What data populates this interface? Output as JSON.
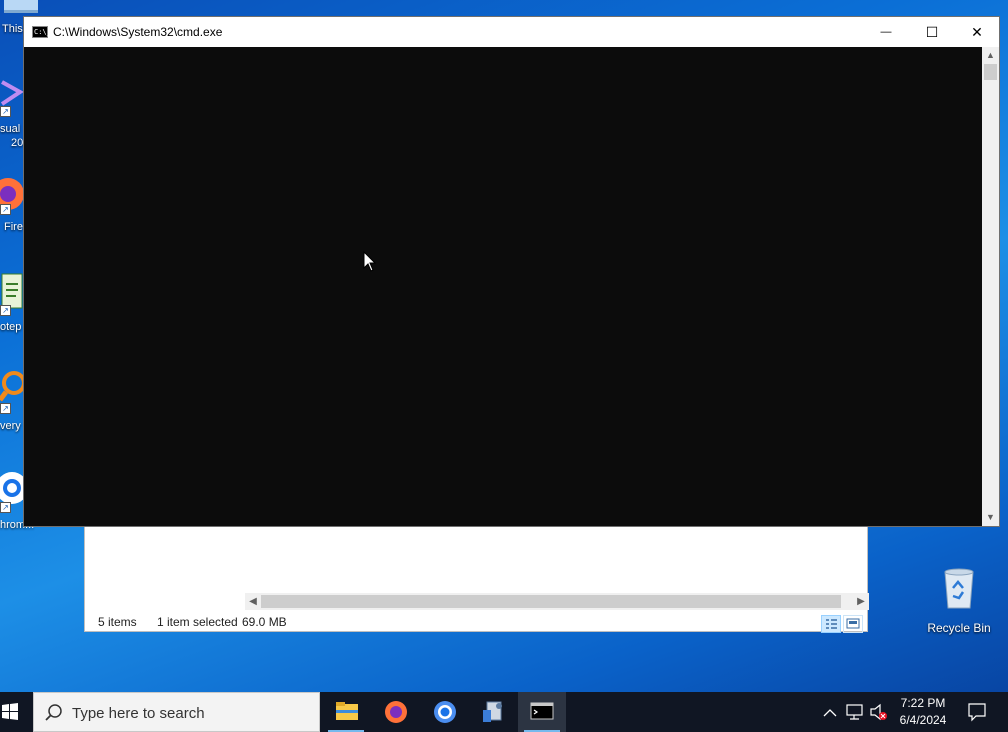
{
  "desktop": {
    "icons": [
      {
        "name": "This PC",
        "visible_text": "This"
      },
      {
        "name": "Visual Studio",
        "visible_text": "sual",
        "line2": "20"
      },
      {
        "name": "Firefox",
        "visible_text": "Fire"
      },
      {
        "name": "Notepad",
        "visible_text": "otep"
      },
      {
        "name": "Everything",
        "visible_text": "very"
      },
      {
        "name": "Chrome",
        "visible_text": "hrom..."
      }
    ],
    "recycle_bin_label": "Recycle Bin"
  },
  "explorer": {
    "status_items": "5 items",
    "status_selected": "1 item selected",
    "status_size": "69.0 MB"
  },
  "cmd": {
    "title": "C:\\Windows\\System32\\cmd.exe",
    "icon_text": "C:\\_",
    "minimize_glyph": "—",
    "maximize_glyph": "☐",
    "close_glyph": "✕"
  },
  "taskbar": {
    "search_placeholder": "Type here to search",
    "apps": [
      "file-explorer",
      "firefox",
      "chrome",
      "settings-app",
      "command-prompt"
    ],
    "time": "7:22 PM",
    "date": "6/4/2024"
  },
  "colors": {
    "console_bg": "#0c0c0c",
    "taskbar_bg": "#101623",
    "running_indicator": "#76b9ed"
  }
}
